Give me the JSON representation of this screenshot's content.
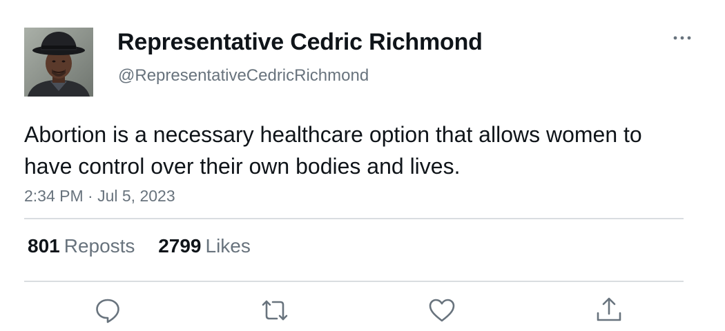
{
  "author": {
    "display_name": "Representative Cedric Richmond",
    "handle": "@RepresentativeCedricRichmond",
    "avatar_icon": "profile-photo"
  },
  "tweet": {
    "text": "Abortion is a necessary healthcare option that allows women to have control over their own bodies and lives.",
    "timestamp": "2:34 PM · Jul 5, 2023"
  },
  "stats": {
    "reposts_count": "801",
    "reposts_label": "Reposts",
    "likes_count": "2799",
    "likes_label": "Likes"
  },
  "actions": [
    {
      "icon": "reply-icon"
    },
    {
      "icon": "repost-icon"
    },
    {
      "icon": "like-icon"
    },
    {
      "icon": "share-icon"
    }
  ],
  "colors": {
    "text_primary": "#0f1419",
    "text_secondary": "#68737d",
    "divider": "#d9dde0"
  }
}
